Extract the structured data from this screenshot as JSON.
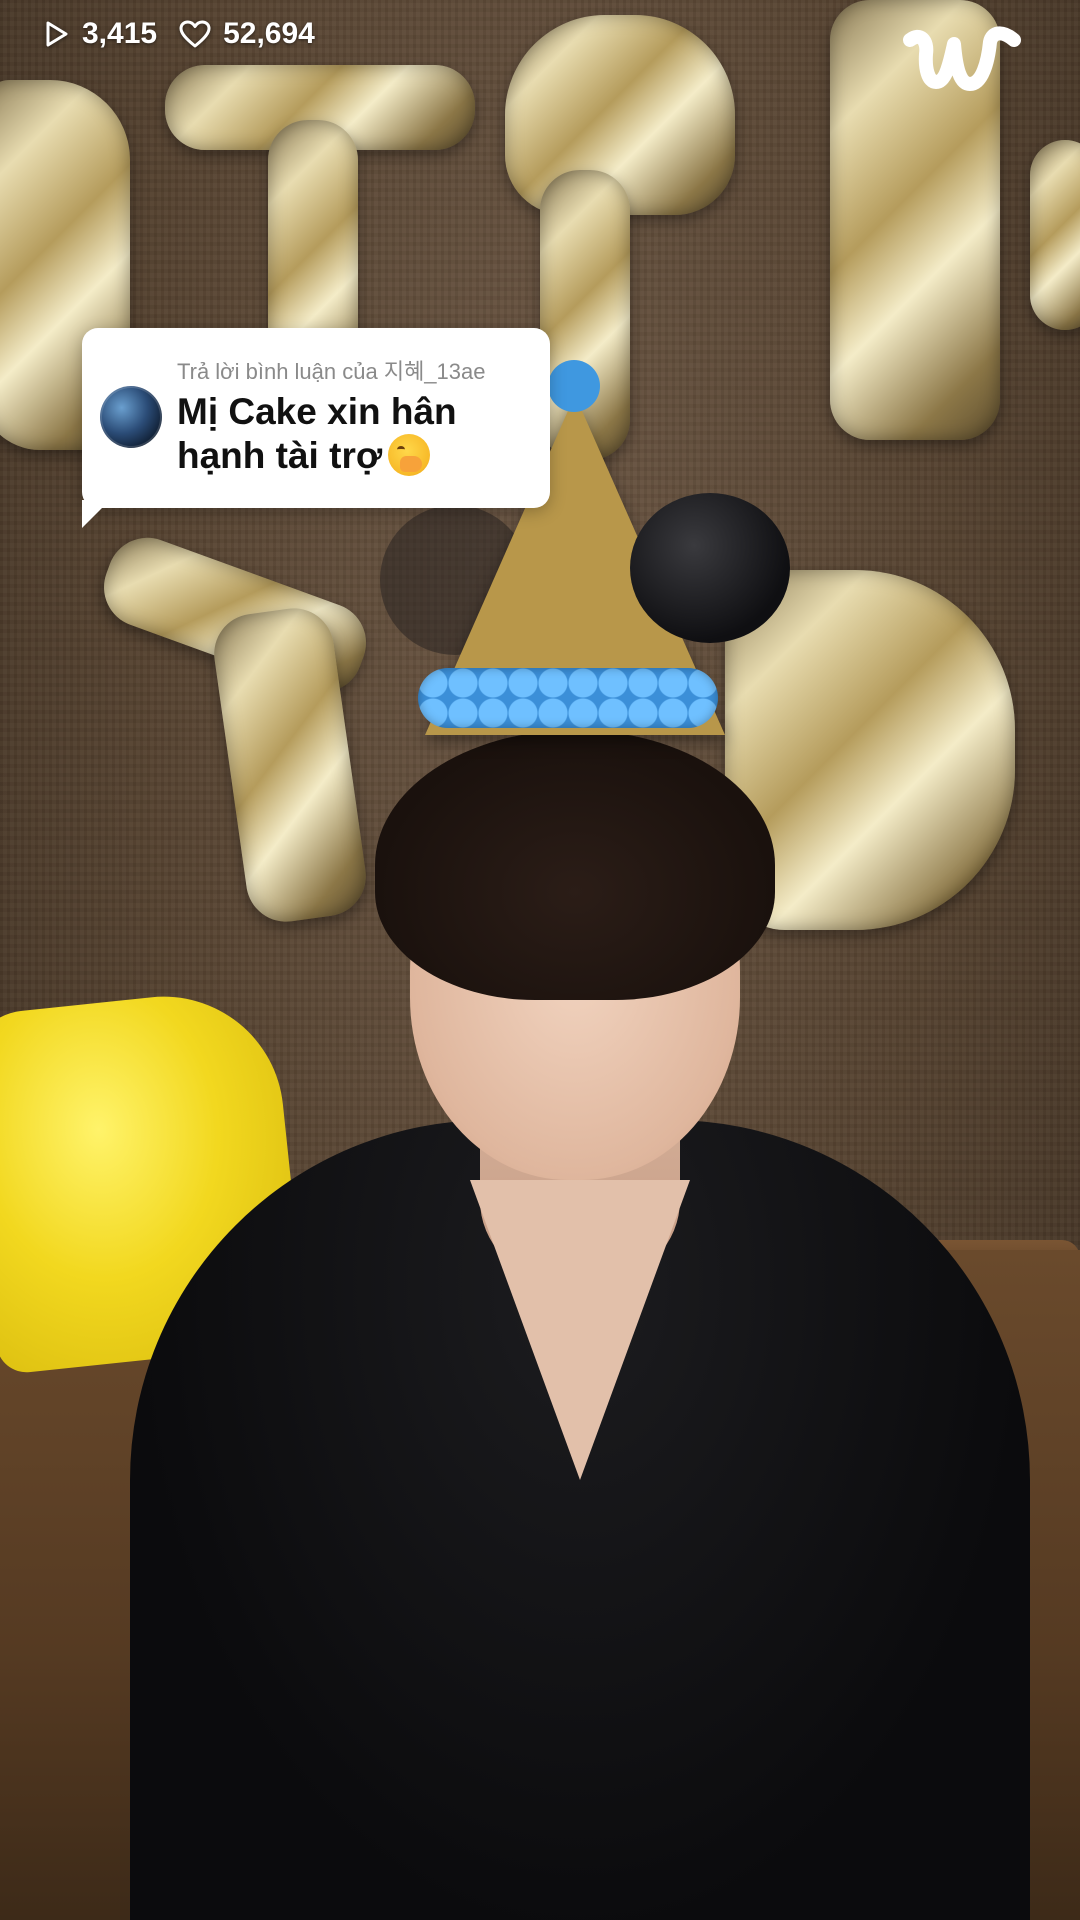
{
  "overlay": {
    "views": "3,415",
    "likes": "52,694",
    "views_icon": "play-icon",
    "likes_icon": "heart-icon",
    "logo_icon": "weverse-logo-icon"
  },
  "reply_card": {
    "label": "Trả lời bình luận của 지혜_13ae",
    "text": "Mị Cake xin hân hạnh tài trợ",
    "emoji_icon": "hand-over-mouth-emoji-icon"
  },
  "colors": {
    "overlay_text": "#ffffff",
    "card_bg": "#ffffff",
    "label_gray": "#8a8a8a",
    "text_dark": "#111111"
  }
}
